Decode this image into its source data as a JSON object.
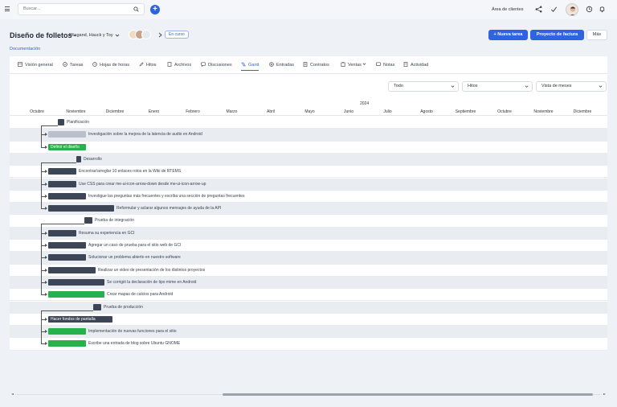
{
  "topbar": {
    "search_placeholder": "Buscar...",
    "add_label": "+",
    "client_area": "Área de clientes"
  },
  "project": {
    "title": "Diseño de folletos",
    "separator": " - ",
    "client": "Wiegand, Hauck y Toy",
    "status": "En curso",
    "doc_link": "Documentación"
  },
  "actions": {
    "new_task": "+ Nueva tarea",
    "invoice": "Proyecto de factura",
    "more": "Más"
  },
  "tabs": [
    {
      "label": "Visión general",
      "icon": "overview-icon"
    },
    {
      "label": "Tareas",
      "icon": "tasks-icon"
    },
    {
      "label": "Hojas de horas",
      "icon": "clock-icon"
    },
    {
      "label": "Hitos",
      "icon": "rocket-icon"
    },
    {
      "label": "Archivos",
      "icon": "files-icon"
    },
    {
      "label": "Discusiones",
      "icon": "chat-icon"
    },
    {
      "label": "Gantt",
      "icon": "gantt-icon",
      "active": true
    },
    {
      "label": "Entradas",
      "icon": "tickets-icon"
    },
    {
      "label": "Contratos",
      "icon": "contract-icon"
    },
    {
      "label": "Ventas",
      "icon": "sales-icon"
    },
    {
      "label": "Notas",
      "icon": "notes-icon"
    },
    {
      "label": "Actividad",
      "icon": "activity-icon"
    }
  ],
  "filters": {
    "filter1": "Todo",
    "filter2": "Hitos",
    "filter3": "Vista de meses"
  },
  "gantt": {
    "year": "2024",
    "months": [
      "Octubre",
      "Noviembre",
      "Diciembre",
      "Enero",
      "Febrero",
      "Marzo",
      "Abril",
      "Mayo",
      "Junio",
      "Julio",
      "Agosto",
      "Septiembre",
      "Octubre",
      "Noviembre",
      "Diciembre"
    ],
    "rows": [
      {
        "label": "Planificación",
        "kind": "milestone"
      },
      {
        "label": "Investigación sobre la mejora de la latencia de audio en Android",
        "kind": "gray"
      },
      {
        "label": "Definir el diseño",
        "kind": "green",
        "inside": true
      },
      {
        "label": "Desarrollo",
        "kind": "milestone"
      },
      {
        "label": "Encontrar/arreglar 10 enlaces rotos en la Wiki de RTEMS",
        "kind": "dark"
      },
      {
        "label": "Use CSS para crear me-ui-icon-arrow-down desde me-ui-icon-arrow-up",
        "kind": "dark"
      },
      {
        "label": "Investigue las preguntas más frecuentes y escriba una sección de preguntas frecuentes",
        "kind": "dark"
      },
      {
        "label": "Reformular y aclarar algunos mensajes de ayuda de la API",
        "kind": "dark"
      },
      {
        "label": "Prueba de integración",
        "kind": "milestone"
      },
      {
        "label": "Resuma su experiencia en GCI",
        "kind": "dark"
      },
      {
        "label": "Agregar un caso de prueba para el sitio web de GCI",
        "kind": "dark"
      },
      {
        "label": "Solucionar un problema abierto en nuestro software",
        "kind": "dark"
      },
      {
        "label": "Realizar un video de presentación de los distintos proyectos",
        "kind": "dark"
      },
      {
        "label": "Se corrigió la declaración de tipo mime en Android",
        "kind": "dark"
      },
      {
        "label": "Crear mapas de calcios para Android",
        "kind": "green"
      },
      {
        "label": "Prueba de producción",
        "kind": "milestone"
      },
      {
        "label": "Hacer fondos de pantalla",
        "kind": "dark",
        "inside": true
      },
      {
        "label": "Implementación de nuevas funciones para el sitio",
        "kind": "green"
      },
      {
        "label": "Escribe una entrada de blog sobre Ubuntu GNOME",
        "kind": "green"
      }
    ]
  }
}
